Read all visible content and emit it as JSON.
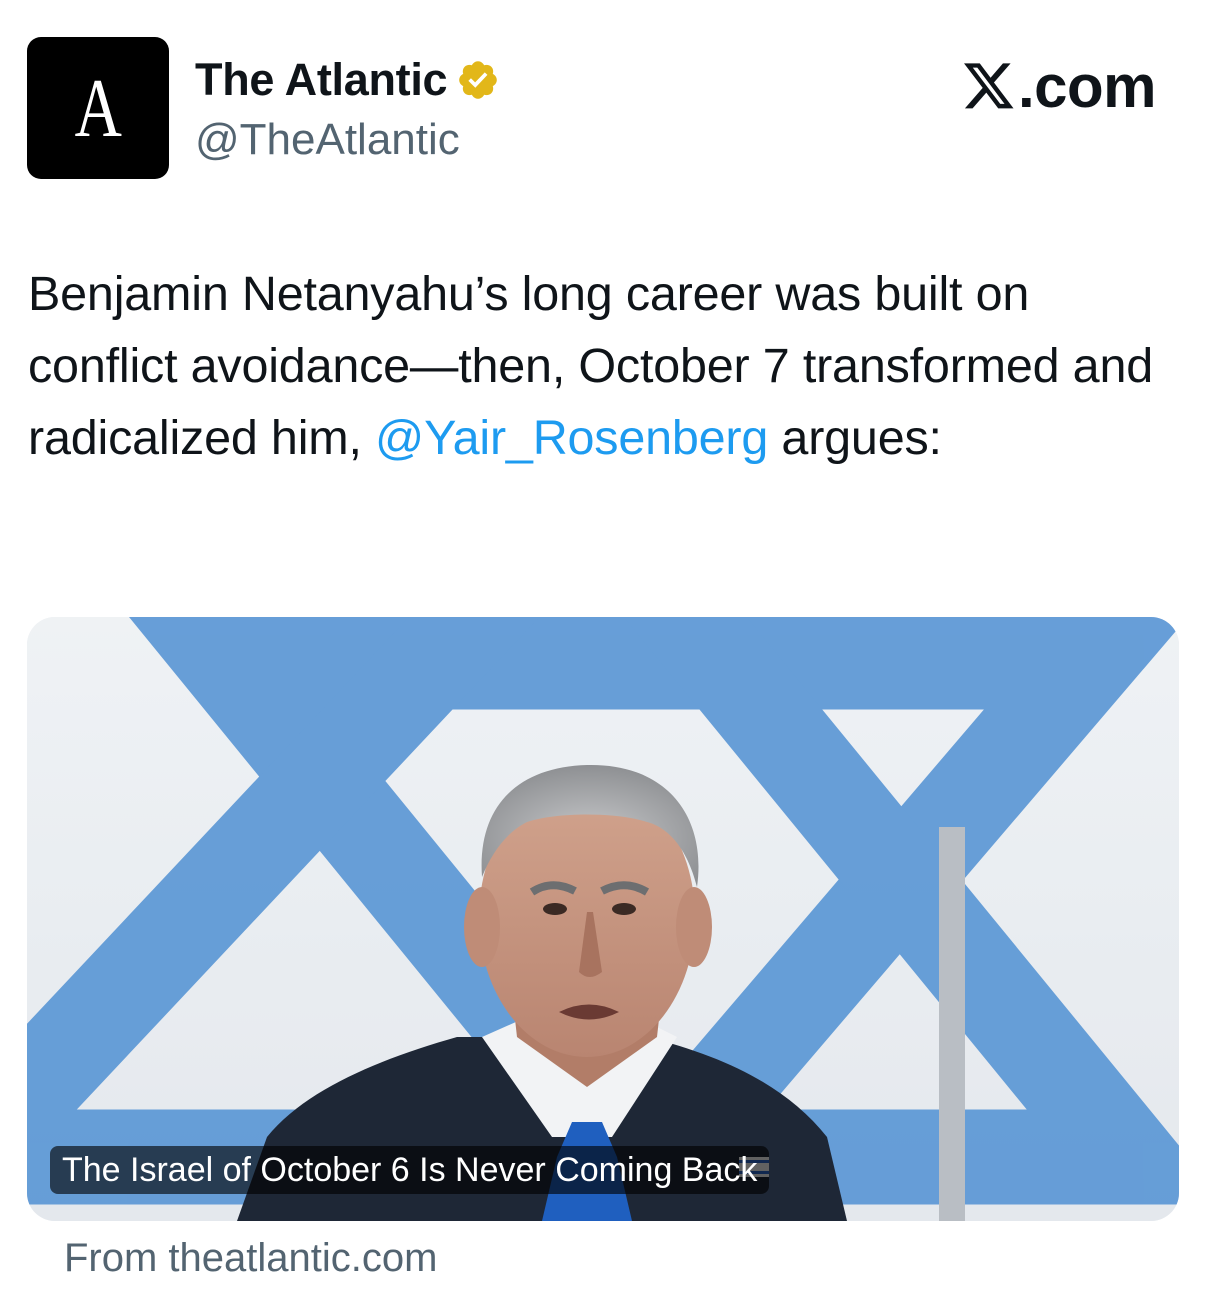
{
  "account": {
    "avatar_letter": "A",
    "display_name": "The Atlantic",
    "handle": "@TheAtlantic",
    "verified_icon": "verified-badge-gold"
  },
  "brand": {
    "label": ".com"
  },
  "tweet": {
    "text_part1": "Benjamin Netanyahu’s long career was built on conflict avoidance—then, October 7 transformed and radicalized him, ",
    "mention": "@Yair_Rosenberg",
    "text_part2": " argues:"
  },
  "card": {
    "image_alt": "Benjamin Netanyahu in front of an Israeli flag",
    "title": "The Israel of October 6 Is Never Coming Back",
    "source": "From theatlantic.com"
  },
  "colors": {
    "link": "#1d9bf0",
    "secondary_text": "#536471",
    "verified_gold": "#e2b719",
    "flag_blue": "#4b8fd4"
  }
}
